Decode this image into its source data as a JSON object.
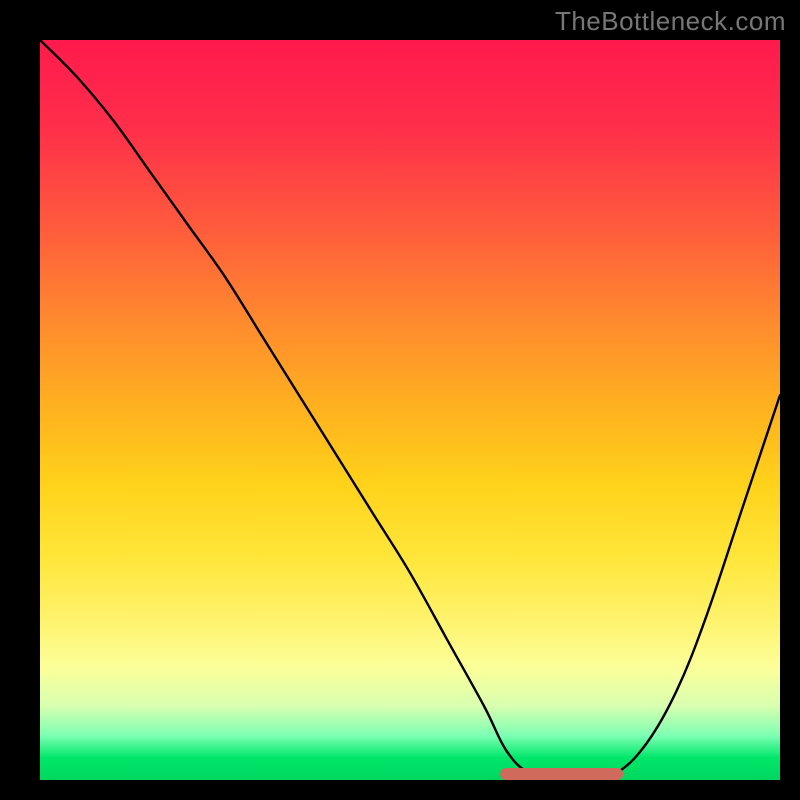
{
  "watermark": "TheBottleneck.com",
  "chart_data": {
    "type": "line",
    "title": "",
    "xlabel": "",
    "ylabel": "",
    "xlim": [
      0,
      100
    ],
    "ylim": [
      0,
      100
    ],
    "background": "rainbow-gradient (red top → green bottom)",
    "series": [
      {
        "name": "bottleneck-curve",
        "color": "#000000",
        "x": [
          0,
          5,
          10,
          15,
          20,
          25,
          30,
          35,
          40,
          45,
          50,
          55,
          60,
          63,
          66,
          70,
          74,
          78,
          82,
          86,
          90,
          95,
          100
        ],
        "y": [
          100,
          95,
          89,
          82,
          75,
          68,
          60,
          52,
          44,
          36,
          28,
          19,
          10,
          4,
          1,
          0,
          0,
          1,
          5,
          12,
          22,
          37,
          52
        ]
      },
      {
        "name": "optimal-band",
        "color": "#d46a5f",
        "x": [
          63,
          78
        ],
        "y": [
          0,
          0
        ]
      }
    ]
  }
}
